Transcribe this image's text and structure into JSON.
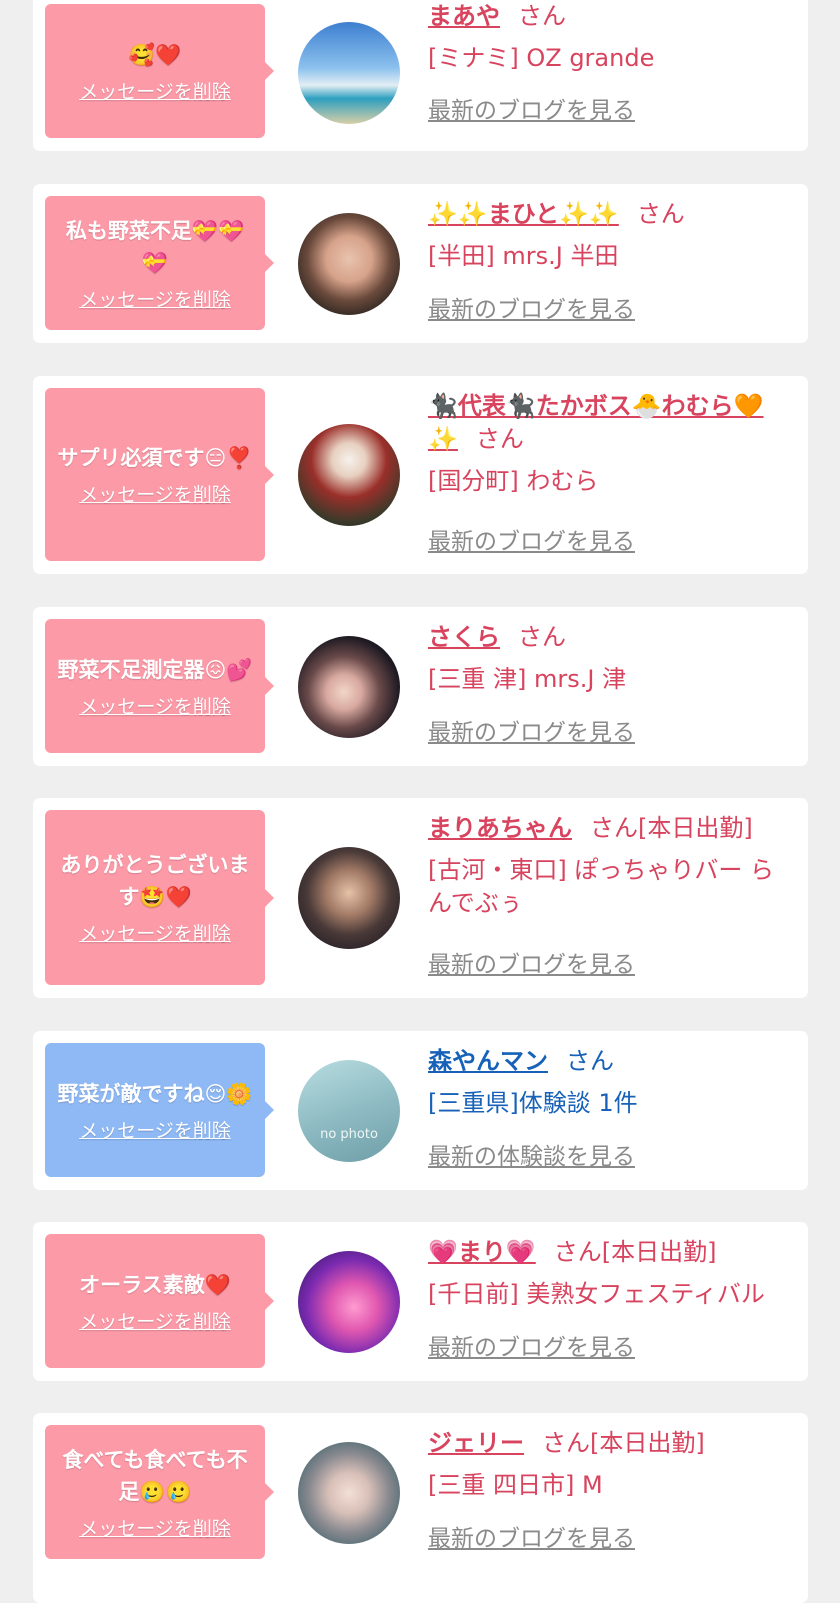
{
  "common": {
    "delete_label": "メッセージを削除",
    "san": "さん",
    "on_duty": "[本日出勤]"
  },
  "items": [
    {
      "message": "🥰❤️",
      "name": "まあや",
      "suffix": "さん",
      "shop": "[ミナミ] OZ grande",
      "link": "最新のブログを見る",
      "type": "pink"
    },
    {
      "message": "私も野菜不足💝💝💝",
      "name": "✨✨まひと✨✨",
      "suffix": "さん",
      "shop": "[半田] mrs.J 半田",
      "link": "最新のブログを見る",
      "type": "pink"
    },
    {
      "message": "サプリ必須です😑❣️",
      "name": "🐈‍⬛代表🐈‍⬛たかボス🐣わむら🧡✨",
      "suffix": "さん",
      "shop": "[国分町] わむら",
      "link": "最新のブログを見る",
      "type": "pink"
    },
    {
      "message": "野菜不足測定器😖💕",
      "name": "さくら",
      "suffix": "さん",
      "shop": "[三重 津] mrs.J 津",
      "link": "最新のブログを見る",
      "type": "pink"
    },
    {
      "message": "ありがとうございます🤩❤️",
      "name": "まりあちゃん",
      "suffix": "さん[本日出勤]",
      "shop": "[古河・東口] ぽっちゃりバー らんでぶぅ",
      "link": "最新のブログを見る",
      "type": "pink"
    },
    {
      "message": "野菜が敵ですね😌🌼",
      "name": "森やんマン",
      "suffix": "さん",
      "shop": "[三重県]体験談 1件",
      "link": "最新の体験談を見る",
      "type": "blue",
      "avatar_text": "no photo"
    },
    {
      "message": "オーラス素敵❤️",
      "name": "💗まり💗",
      "suffix": "さん[本日出勤]",
      "shop": "[千日前] 美熟女フェスティバル",
      "link": "最新のブログを見る",
      "type": "pink"
    },
    {
      "message": "食べても食べても不足🥲🥲",
      "name": "ジェリー",
      "suffix": "さん[本日出勤]",
      "shop": "[三重 四日市] M",
      "link": "最新のブログを見る",
      "type": "pink"
    }
  ],
  "colors": {
    "background": "#efefef",
    "card": "#ffffff",
    "pink_bubble": "#fd9aa8",
    "blue_bubble": "#8fb9f5",
    "pink_text": "#d8435e",
    "blue_text": "#1762b8",
    "gray_link": "#8a8a8a"
  }
}
